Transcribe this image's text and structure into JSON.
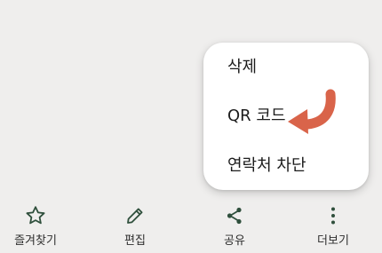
{
  "menu": {
    "items": [
      {
        "label": "삭제"
      },
      {
        "label": "QR 코드"
      },
      {
        "label": "연락처 차단"
      }
    ]
  },
  "bottom_nav": {
    "items": [
      {
        "label": "즐겨찾기",
        "icon": "star-icon"
      },
      {
        "label": "편집",
        "icon": "pencil-icon"
      },
      {
        "label": "공유",
        "icon": "share-icon"
      },
      {
        "label": "더보기",
        "icon": "more-vertical-icon"
      }
    ]
  },
  "colors": {
    "background": "#efeeed",
    "menu_background": "#ffffff",
    "icon_green": "#2f4f3c",
    "arrow": "#d9644a"
  }
}
